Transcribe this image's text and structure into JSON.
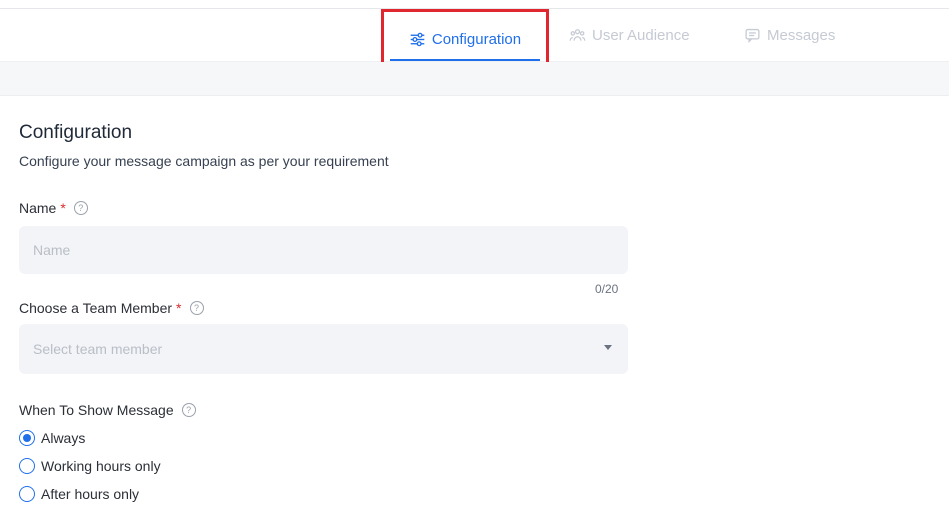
{
  "tabs": [
    {
      "label": "Configuration",
      "icon": "sliders-icon",
      "active": true
    },
    {
      "label": "User Audience",
      "icon": "users-icon",
      "active": false
    },
    {
      "label": "Messages",
      "icon": "message-icon",
      "active": false
    }
  ],
  "page": {
    "title": "Configuration",
    "subtitle": "Configure your message campaign as per your requirement"
  },
  "name_field": {
    "label": "Name",
    "required_mark": "*",
    "placeholder": "Name",
    "counter": "0/20"
  },
  "team_member_field": {
    "label": "Choose a Team Member",
    "required_mark": "*",
    "placeholder": "Select team member"
  },
  "show_message": {
    "label": "When To Show Message",
    "options": [
      {
        "label": "Always",
        "selected": true
      },
      {
        "label": "Working hours only",
        "selected": false
      },
      {
        "label": "After hours only",
        "selected": false
      }
    ]
  },
  "colors": {
    "accent": "#1f6feb",
    "highlight_box": "#e0262f",
    "required": "#d92b2b",
    "inactive_tab": "#c5cad3"
  }
}
